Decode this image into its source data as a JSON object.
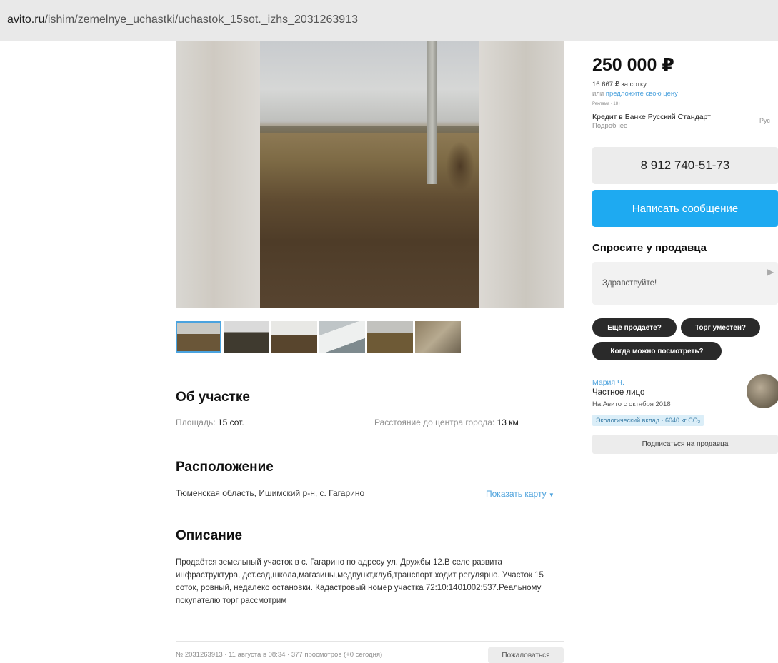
{
  "browser": {
    "url_domain": "avito.ru",
    "url_path": "/ishim/zemelnye_uchastki/uchastok_15sot._izhs_2031263913"
  },
  "gallery": {
    "thumbnail_count": 6,
    "selected_index": 0
  },
  "about": {
    "title": "Об участке",
    "area_label": "Площадь:",
    "area_value": "15 сот.",
    "distance_label": "Расстояние до центра города:",
    "distance_value": "13 км"
  },
  "location": {
    "title": "Расположение",
    "address": "Тюменская область, Ишимский р-н, с. Гагарино",
    "show_map": "Показать карту"
  },
  "description": {
    "title": "Описание",
    "text": "Продаётся земельный участок в с. Гагарино по адресу ул. Дружбы 12.В селе развита инфраструктура, дет.сад,школа,магазины,медпункт,клуб,транспорт ходит регулярно. Участок 15 соток, ровный, недалеко остановки. Кадастровый номер участка 72:10:1401002:537.Реальному покупателю торг рассмотрим"
  },
  "footer": {
    "meta": "№ 2031263913 · 11 августа в 08:34 · 377 просмотров (+0 сегодня)",
    "complain": "Пожаловаться"
  },
  "sidebar": {
    "price": "250 000 ₽",
    "price_per": "16 667 ₽ за сотку",
    "offer_prefix": "или ",
    "offer_link": "предложите свою цену",
    "ad_label": "Реклама · 18+",
    "credit_title": "Кредит в Банке Русский Стандарт",
    "credit_more": "Подробнее",
    "credit_logo": "Рус",
    "phone": "8 912 740-51-73",
    "message_button": "Написать сообщение",
    "ask_title": "Спросите у продавца",
    "ask_value": "Здравствуйте!",
    "chips": [
      "Ещё продаёте?",
      "Торг уместен?",
      "Когда можно посмотреть?"
    ],
    "seller_name": "Мария Ч.",
    "seller_type": "Частное лицо",
    "seller_since": "На Авито с октября 2018",
    "eco_badge": "Экологический вклад · 6040 кг CO₂",
    "subscribe": "Подписаться на продавца"
  },
  "colors": {
    "accent": "#1eaaf1",
    "link": "#4ea3dd",
    "chip_bg": "#2a2a2a"
  }
}
